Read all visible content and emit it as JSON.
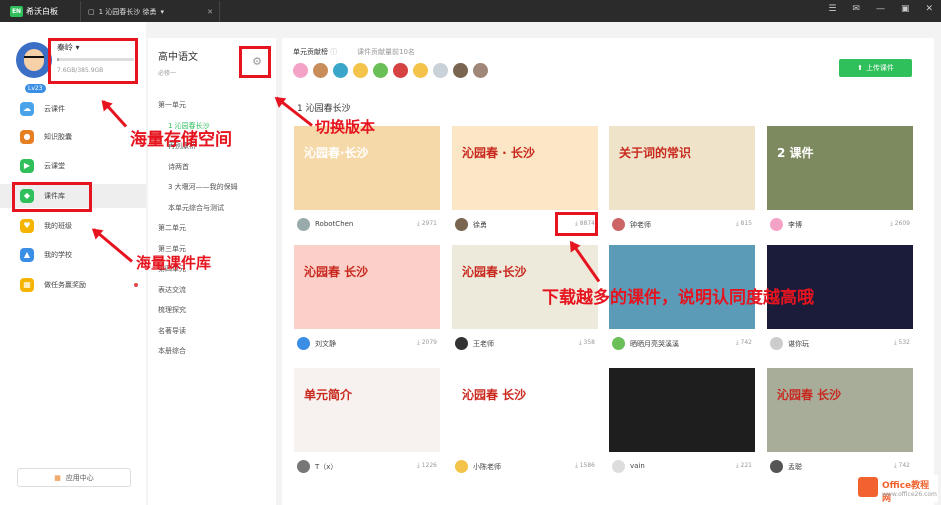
{
  "app": {
    "name": "希沃白板",
    "tab": "1 沁园春长沙 徐勇",
    "logo_mark": "EN"
  },
  "user": {
    "name": "秦岭",
    "storage": "7.6GB/385.9GB",
    "storage_fraction": 0.02,
    "level": "Lv23"
  },
  "nav": [
    {
      "label": "云课件",
      "icon": "cloud-icon",
      "color": "#4aa3e8"
    },
    {
      "label": "知识胶囊",
      "icon": "capsule-icon",
      "color": "#e67e22"
    },
    {
      "label": "云课堂",
      "icon": "classroom-icon",
      "color": "#2fbf5b"
    },
    {
      "label": "课件库",
      "icon": "library-icon",
      "color": "#2fbf5b"
    },
    {
      "label": "我的班级",
      "icon": "class-icon",
      "color": "#f5b400"
    },
    {
      "label": "我的学校",
      "icon": "school-icon",
      "color": "#3b8ee6"
    },
    {
      "label": "做任务赢奖励",
      "icon": "gift-icon",
      "color": "#f5b400"
    }
  ],
  "app_center": "应用中心",
  "middle": {
    "subject": "高中语文",
    "required": "必修一",
    "tree": [
      {
        "label": "第一单元",
        "level": 0
      },
      {
        "label": "1 沁园春长沙",
        "level": 1,
        "active": true
      },
      {
        "label": "再别康桥",
        "level": 1
      },
      {
        "label": "诗两首",
        "level": 1
      },
      {
        "label": "3 大堰河——我的保姆",
        "level": 1
      },
      {
        "label": "本单元综合与测试",
        "level": 1
      },
      {
        "label": "第二单元",
        "level": 0
      },
      {
        "label": "第三单元",
        "level": 0
      },
      {
        "label": "第四单元",
        "level": 0
      },
      {
        "label": "表达交流",
        "level": 0
      },
      {
        "label": "梳理探究",
        "level": 0
      },
      {
        "label": "名著导读",
        "level": 0
      },
      {
        "label": "本册综合",
        "level": 0
      }
    ]
  },
  "contributors": {
    "title": "单元贡献榜",
    "subtitle": "课件贡献量前10名",
    "colors": [
      "#f4a3c7",
      "#c98d5b",
      "#3aa6c9",
      "#f3c34a",
      "#6bbf59",
      "#d64141",
      "#f3c34a",
      "#c9d1d9",
      "#7a6650",
      "#a08777"
    ]
  },
  "upload_label": "上传课件",
  "section_title": "1 沁园春长沙",
  "cards": [
    {
      "author": "RobotChen",
      "downloads": "2971",
      "title": "沁园春·长沙",
      "bg": "#f6d9a8",
      "av": "#9aa"
    },
    {
      "author": "徐勇",
      "downloads": "8874",
      "title": "沁园春 · 长沙",
      "bg": "#fbe6c6",
      "av": "#7a6650"
    },
    {
      "author": "钟老师",
      "downloads": "815",
      "title": "关于词的常识",
      "bg": "#efe4c9",
      "av": "#c66"
    },
    {
      "author": "李博",
      "downloads": "2609",
      "title": "2 课件",
      "bg": "#7d8a5f",
      "av": "#f4a3c7"
    },
    {
      "author": "刘文静",
      "downloads": "2079",
      "title": "沁园春 长沙",
      "bg": "#fbd0c8",
      "av": "#3b8ee6"
    },
    {
      "author": "王老师",
      "downloads": "358",
      "title": "沁园春·长沙",
      "bg": "#eeeadb",
      "av": "#333"
    },
    {
      "author": "晒晒月亮哭溪溪",
      "downloads": "742",
      "title": "",
      "bg": "#5c9bb8",
      "av": "#6bbf59"
    },
    {
      "author": "谌你玩",
      "downloads": "532",
      "title": "",
      "bg": "#1b1b3a",
      "av": "#ccc"
    },
    {
      "author": "T（x）",
      "downloads": "1226",
      "title": "单元简介",
      "bg": "#f7f2ef",
      "av": "#777"
    },
    {
      "author": "小陈老师",
      "downloads": "1586",
      "title": "沁园春 长沙",
      "bg": "#fff",
      "av": "#f3c34a"
    },
    {
      "author": "vain",
      "downloads": "221",
      "title": "",
      "bg": "#1e1e1e",
      "av": "#ddd"
    },
    {
      "author": "孟聪",
      "downloads": "742",
      "title": "沁园春 长沙",
      "bg": "#a8ad9a",
      "av": "#555"
    }
  ],
  "annotations": {
    "storage": "海量存储空间",
    "version": "切换版本",
    "library": "海量课件库",
    "downloads": "下载越多的课件，说明认同度越高哦"
  },
  "watermark": {
    "brand": "Office教程网",
    "url": "www.office26.com"
  }
}
